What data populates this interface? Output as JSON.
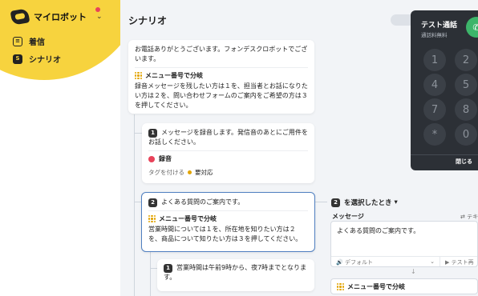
{
  "app": {
    "name": "マイロボット"
  },
  "nav": [
    {
      "label": "着信"
    },
    {
      "label": "シナリオ"
    }
  ],
  "page": {
    "title": "シナリオ"
  },
  "intro_card": {
    "text": "お電話ありがとうございます。フォンデスクロボットでございます。",
    "menu_title": "メニュー番号で分岐",
    "menu_text": "録音メッセージを残したい方は１を、担当者とお話になりたい方は２を、問い合わせフォームのご案内をご希望の方は３を押してください。"
  },
  "branch1": {
    "num": "1",
    "text": "メッセージを録音します。発信音のあとにご用件をお話しください。",
    "record_label": "録音",
    "tag_label": "タグを付ける",
    "status_label": "要対応"
  },
  "branch2": {
    "num": "2",
    "text": "よくある質問のご案内です。",
    "menu_title": "メニュー番号で分岐",
    "menu_text": "営業時間については１を、所在地を知りたい方は２を、商品について知りたい方は３を押してください。"
  },
  "sub1": {
    "num": "1",
    "text": "営業時間は午前9時から、夜7時までとなります。"
  },
  "right_panel": {
    "num": "2",
    "header": "を選択したとき",
    "message_label": "メッセージ",
    "text_tab": "テキ",
    "message_text": "よくある質問のご案内です。",
    "voice_select": "デフォルト",
    "test_button": "テスト再",
    "menu_title": "メニュー番号で分岐"
  },
  "phone": {
    "title": "テスト通話",
    "subtitle": "通話料無料",
    "keys": [
      "1",
      "2",
      "4",
      "5",
      "7",
      "8",
      "*",
      "0"
    ],
    "close_label": "閉じる"
  },
  "colors": {
    "accent": "#f7d33e",
    "record": "#e8435a",
    "selected_border": "#4f7fc0",
    "call": "#3db56a"
  }
}
